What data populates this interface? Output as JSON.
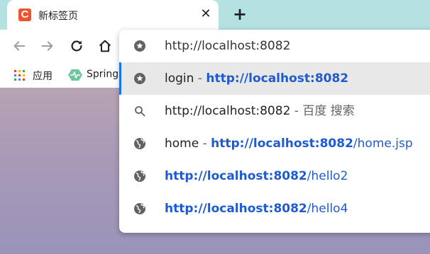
{
  "tab": {
    "favicon_letter": "C",
    "title": "新标签页",
    "close_glyph": "✕"
  },
  "new_tab_glyph": "+",
  "bookmarks": [
    {
      "label": "应用",
      "icon": "apps-grid-icon"
    },
    {
      "label": "Spring",
      "icon": "spring-icon"
    }
  ],
  "omnibox": {
    "value": "http://localhost:8082"
  },
  "suggestions": [
    {
      "icon": "star-icon",
      "title": "login",
      "sep": " - ",
      "url_bold": "http://localhost:8082",
      "url_rest": "",
      "selected": true
    },
    {
      "icon": "search-icon",
      "query": "http://localhost:8082",
      "sep": " - ",
      "engine": "百度 搜索"
    },
    {
      "icon": "globe-icon",
      "title": "home",
      "sep": " - ",
      "url_bold": "http://localhost:8082",
      "url_rest": "/home.jsp"
    },
    {
      "icon": "globe-icon",
      "url_bold": "http://localhost:8082",
      "url_rest": "/hello2"
    },
    {
      "icon": "globe-icon",
      "url_bold": "http://localhost:8082",
      "url_rest": "/hello4"
    }
  ],
  "colors": {
    "tabstrip": "#b4e2e3",
    "link": "#1f5bd0",
    "selection_accent": "#1a73e8",
    "favicon": "#f0522c"
  }
}
